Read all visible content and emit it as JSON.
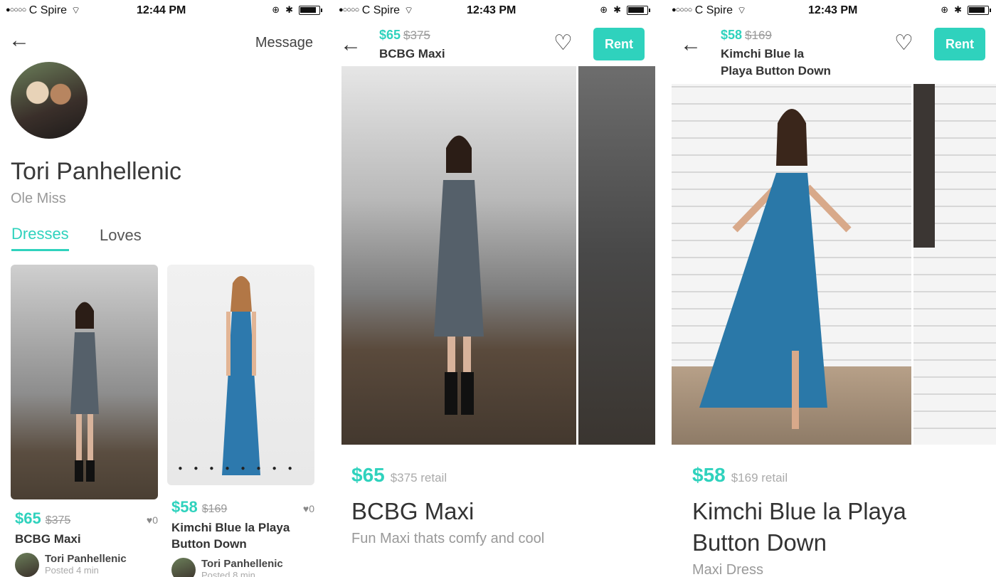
{
  "screens": {
    "profile": {
      "status": {
        "carrier": "C Spire",
        "time": "12:44 PM"
      },
      "message_label": "Message",
      "name": "Tori Panhellenic",
      "school": "Ole Miss",
      "tabs": [
        {
          "label": "Dresses",
          "active": true
        },
        {
          "label": "Loves",
          "active": false
        }
      ],
      "cards": [
        {
          "price": "$65",
          "original": "$375",
          "likes": "0",
          "title": "BCBG Maxi",
          "owner": "Tori Panhellenic",
          "posted": "Posted 4 min"
        },
        {
          "price": "$58",
          "original": "$169",
          "likes": "0",
          "title": "Kimchi Blue la Playa Button Down",
          "owner": "Tori Panhellenic",
          "posted": "Posted 8 min"
        }
      ]
    },
    "product1": {
      "status": {
        "carrier": "C Spire",
        "time": "12:43 PM"
      },
      "header_price": "$65",
      "header_original": "$375",
      "header_title": "BCBG Maxi",
      "rent_label": "Rent",
      "price": "$65",
      "retail": "$375 retail",
      "title": "BCBG Maxi",
      "description": "Fun Maxi thats comfy and cool"
    },
    "product2": {
      "status": {
        "carrier": "C Spire",
        "time": "12:43 PM"
      },
      "header_price": "$58",
      "header_original": "$169",
      "header_title_line1": "Kimchi Blue la",
      "header_title_line2": "Playa Button Down",
      "rent_label": "Rent",
      "price": "$58",
      "retail": "$169 retail",
      "title_line1": "Kimchi Blue la Playa",
      "title_line2": "Button Down",
      "category": "Maxi Dress"
    }
  },
  "colors": {
    "accent": "#2fd2bd"
  },
  "icons": [
    "back-arrow-icon",
    "heart-icon",
    "wifi-icon",
    "bluetooth-icon",
    "battery-icon",
    "lock-rotation-icon"
  ]
}
